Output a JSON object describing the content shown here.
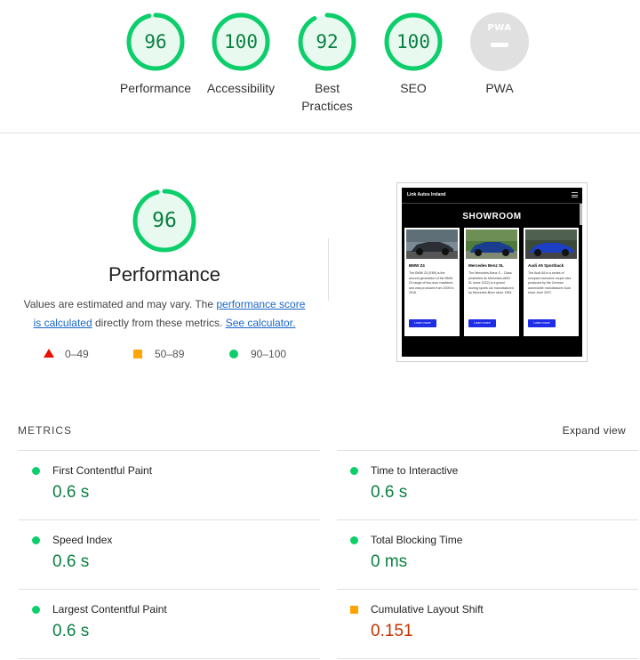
{
  "top_gauges": [
    {
      "score": "96",
      "label": "Performance",
      "value": 96,
      "color": "#0cce6b"
    },
    {
      "score": "100",
      "label": "Accessibility",
      "value": 100,
      "color": "#0cce6b"
    },
    {
      "score": "92",
      "label": "Best Practices",
      "value": 92,
      "color": "#0cce6b"
    },
    {
      "score": "100",
      "label": "SEO",
      "value": 100,
      "color": "#0cce6b"
    }
  ],
  "pwa": {
    "badge": "PWA",
    "label": "PWA"
  },
  "performance": {
    "score": "96",
    "value": 96,
    "title": "Performance",
    "desc_1": "Values are estimated and may vary. The ",
    "link_score": "performance score is calculated",
    "desc_2": " directly from these metrics. ",
    "link_calc": "See calculator.",
    "legend": {
      "fail": "0–49",
      "average": "50–89",
      "pass": "90–100"
    }
  },
  "thumbnail": {
    "brand": "Link Autos Ireland",
    "heading": "SHOWROOM",
    "cars": [
      {
        "name": "BMW Z4",
        "desc": "The BMW Z4 (E89) is the second generation of the BMW Z4 range of two-door roadsters, and was produced from 2009 to 2016.",
        "button": "Learn more"
      },
      {
        "name": "Mercedes Benz SL",
        "desc": "The Mercedes-Benz S... Class (marketed as Mercedes-AMG SL since 2022) is a grand touring sports car manufactured by Mercedes-Benz since 1954.",
        "button": "Learn more"
      },
      {
        "name": "Audi A5 Sportback",
        "desc": "The Audi A5 is a series of compact executive coupé cars produced by the German automobile manufacturer Audi since June 2007.",
        "button": "Learn more"
      }
    ]
  },
  "metrics": {
    "header": "METRICS",
    "expand": "Expand view",
    "items": [
      {
        "title": "First Contentful Paint",
        "value": "0.6 s",
        "status": "pass"
      },
      {
        "title": "Time to Interactive",
        "value": "0.6 s",
        "status": "pass"
      },
      {
        "title": "Speed Index",
        "value": "0.6 s",
        "status": "pass"
      },
      {
        "title": "Total Blocking Time",
        "value": "0 ms",
        "status": "pass"
      },
      {
        "title": "Largest Contentful Paint",
        "value": "0.6 s",
        "status": "pass"
      },
      {
        "title": "Cumulative Layout Shift",
        "value": "0.151",
        "status": "average"
      }
    ]
  },
  "colors": {
    "pass": "#0cce6b",
    "pass_text": "#0b8043",
    "average": "#ffa400",
    "average_text": "#c33300",
    "fail": "#eb0f00",
    "link": "#1a66c9"
  }
}
